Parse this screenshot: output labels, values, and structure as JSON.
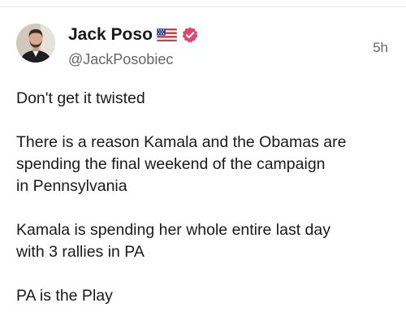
{
  "author": {
    "display_name": "Jack Poso",
    "handle": "@JackPosobiec",
    "flag_icon": "us-flag-icon",
    "verified_icon": "verified-badge-icon",
    "verified_color": "#d94a6a"
  },
  "post": {
    "timestamp": "5h",
    "paragraphs": [
      "Don't get it twisted",
      "There is a reason Kamala and the Obamas are\nspending the final weekend of the campaign\nin Pennsylvania",
      "Kamala is spending her whole entire last day\nwith 3 rallies in PA",
      "PA is the Play"
    ]
  }
}
